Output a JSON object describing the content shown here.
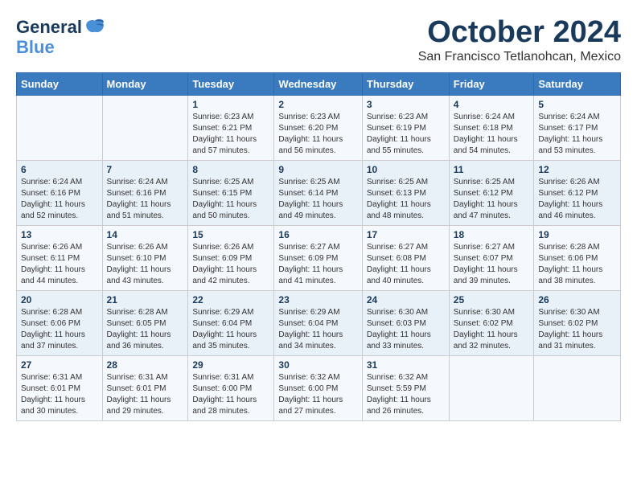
{
  "logo": {
    "general": "General",
    "blue": "Blue",
    "tagline": "GeneralBlue"
  },
  "title": "October 2024",
  "location": "San Francisco Tetlanohcan, Mexico",
  "headers": [
    "Sunday",
    "Monday",
    "Tuesday",
    "Wednesday",
    "Thursday",
    "Friday",
    "Saturday"
  ],
  "weeks": [
    [
      {
        "day": "",
        "info": ""
      },
      {
        "day": "",
        "info": ""
      },
      {
        "day": "1",
        "info": "Sunrise: 6:23 AM\nSunset: 6:21 PM\nDaylight: 11 hours and 57 minutes."
      },
      {
        "day": "2",
        "info": "Sunrise: 6:23 AM\nSunset: 6:20 PM\nDaylight: 11 hours and 56 minutes."
      },
      {
        "day": "3",
        "info": "Sunrise: 6:23 AM\nSunset: 6:19 PM\nDaylight: 11 hours and 55 minutes."
      },
      {
        "day": "4",
        "info": "Sunrise: 6:24 AM\nSunset: 6:18 PM\nDaylight: 11 hours and 54 minutes."
      },
      {
        "day": "5",
        "info": "Sunrise: 6:24 AM\nSunset: 6:17 PM\nDaylight: 11 hours and 53 minutes."
      }
    ],
    [
      {
        "day": "6",
        "info": "Sunrise: 6:24 AM\nSunset: 6:16 PM\nDaylight: 11 hours and 52 minutes."
      },
      {
        "day": "7",
        "info": "Sunrise: 6:24 AM\nSunset: 6:16 PM\nDaylight: 11 hours and 51 minutes."
      },
      {
        "day": "8",
        "info": "Sunrise: 6:25 AM\nSunset: 6:15 PM\nDaylight: 11 hours and 50 minutes."
      },
      {
        "day": "9",
        "info": "Sunrise: 6:25 AM\nSunset: 6:14 PM\nDaylight: 11 hours and 49 minutes."
      },
      {
        "day": "10",
        "info": "Sunrise: 6:25 AM\nSunset: 6:13 PM\nDaylight: 11 hours and 48 minutes."
      },
      {
        "day": "11",
        "info": "Sunrise: 6:25 AM\nSunset: 6:12 PM\nDaylight: 11 hours and 47 minutes."
      },
      {
        "day": "12",
        "info": "Sunrise: 6:26 AM\nSunset: 6:12 PM\nDaylight: 11 hours and 46 minutes."
      }
    ],
    [
      {
        "day": "13",
        "info": "Sunrise: 6:26 AM\nSunset: 6:11 PM\nDaylight: 11 hours and 44 minutes."
      },
      {
        "day": "14",
        "info": "Sunrise: 6:26 AM\nSunset: 6:10 PM\nDaylight: 11 hours and 43 minutes."
      },
      {
        "day": "15",
        "info": "Sunrise: 6:26 AM\nSunset: 6:09 PM\nDaylight: 11 hours and 42 minutes."
      },
      {
        "day": "16",
        "info": "Sunrise: 6:27 AM\nSunset: 6:09 PM\nDaylight: 11 hours and 41 minutes."
      },
      {
        "day": "17",
        "info": "Sunrise: 6:27 AM\nSunset: 6:08 PM\nDaylight: 11 hours and 40 minutes."
      },
      {
        "day": "18",
        "info": "Sunrise: 6:27 AM\nSunset: 6:07 PM\nDaylight: 11 hours and 39 minutes."
      },
      {
        "day": "19",
        "info": "Sunrise: 6:28 AM\nSunset: 6:06 PM\nDaylight: 11 hours and 38 minutes."
      }
    ],
    [
      {
        "day": "20",
        "info": "Sunrise: 6:28 AM\nSunset: 6:06 PM\nDaylight: 11 hours and 37 minutes."
      },
      {
        "day": "21",
        "info": "Sunrise: 6:28 AM\nSunset: 6:05 PM\nDaylight: 11 hours and 36 minutes."
      },
      {
        "day": "22",
        "info": "Sunrise: 6:29 AM\nSunset: 6:04 PM\nDaylight: 11 hours and 35 minutes."
      },
      {
        "day": "23",
        "info": "Sunrise: 6:29 AM\nSunset: 6:04 PM\nDaylight: 11 hours and 34 minutes."
      },
      {
        "day": "24",
        "info": "Sunrise: 6:30 AM\nSunset: 6:03 PM\nDaylight: 11 hours and 33 minutes."
      },
      {
        "day": "25",
        "info": "Sunrise: 6:30 AM\nSunset: 6:02 PM\nDaylight: 11 hours and 32 minutes."
      },
      {
        "day": "26",
        "info": "Sunrise: 6:30 AM\nSunset: 6:02 PM\nDaylight: 11 hours and 31 minutes."
      }
    ],
    [
      {
        "day": "27",
        "info": "Sunrise: 6:31 AM\nSunset: 6:01 PM\nDaylight: 11 hours and 30 minutes."
      },
      {
        "day": "28",
        "info": "Sunrise: 6:31 AM\nSunset: 6:01 PM\nDaylight: 11 hours and 29 minutes."
      },
      {
        "day": "29",
        "info": "Sunrise: 6:31 AM\nSunset: 6:00 PM\nDaylight: 11 hours and 28 minutes."
      },
      {
        "day": "30",
        "info": "Sunrise: 6:32 AM\nSunset: 6:00 PM\nDaylight: 11 hours and 27 minutes."
      },
      {
        "day": "31",
        "info": "Sunrise: 6:32 AM\nSunset: 5:59 PM\nDaylight: 11 hours and 26 minutes."
      },
      {
        "day": "",
        "info": ""
      },
      {
        "day": "",
        "info": ""
      }
    ]
  ]
}
